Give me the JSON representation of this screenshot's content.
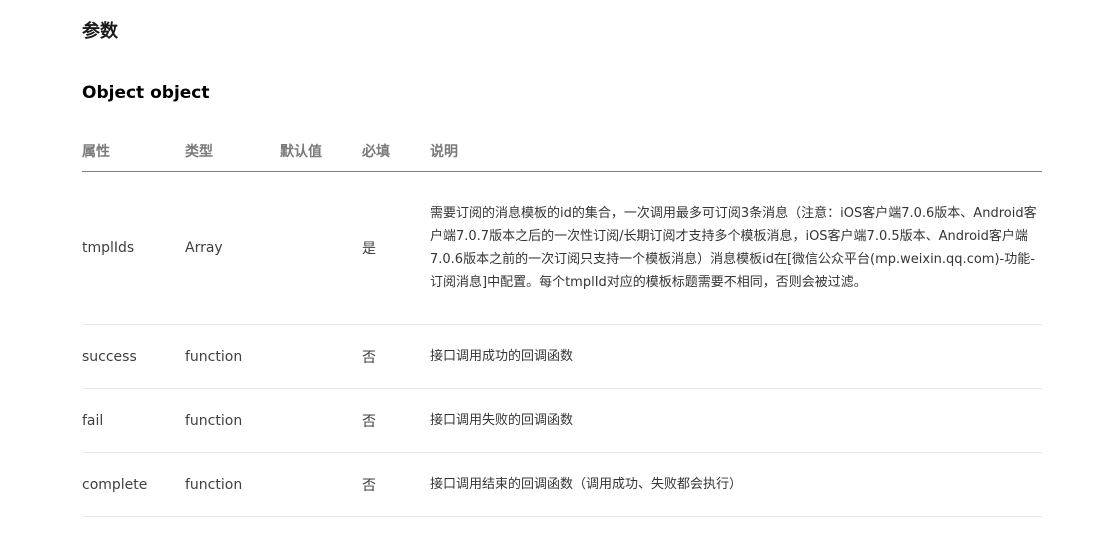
{
  "section_title": "参数",
  "object_title": "Object object",
  "table": {
    "headers": {
      "property": "属性",
      "type": "类型",
      "default": "默认值",
      "required": "必填",
      "description": "说明"
    },
    "rows": [
      {
        "property": "tmplIds",
        "type": "Array",
        "default": "",
        "required": "是",
        "description": "需要订阅的消息模板的id的集合，一次调用最多可订阅3条消息（注意：iOS客户端7.0.6版本、Android客户端7.0.7版本之后的一次性订阅/长期订阅才支持多个模板消息，iOS客户端7.0.5版本、Android客户端7.0.6版本之前的一次订阅只支持一个模板消息）消息模板id在[微信公众平台(mp.weixin.qq.com)-功能-订阅消息]中配置。每个tmplId对应的模板标题需要不相同，否则会被过滤。"
      },
      {
        "property": "success",
        "type": "function",
        "default": "",
        "required": "否",
        "description": "接口调用成功的回调函数"
      },
      {
        "property": "fail",
        "type": "function",
        "default": "",
        "required": "否",
        "description": "接口调用失败的回调函数"
      },
      {
        "property": "complete",
        "type": "function",
        "default": "",
        "required": "否",
        "description": "接口调用结束的回调函数（调用成功、失败都会执行）"
      }
    ]
  }
}
